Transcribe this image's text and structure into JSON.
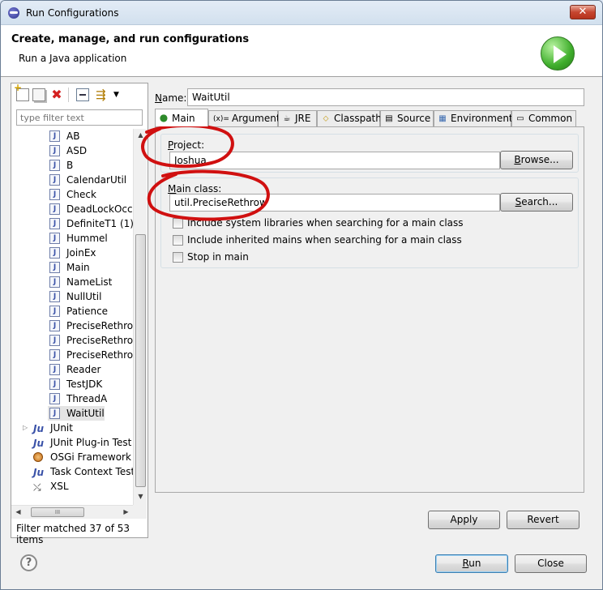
{
  "window": {
    "title": "Run Configurations",
    "close_glyph": "✕"
  },
  "header": {
    "title": "Create, manage, and run configurations",
    "subtitle": "Run a Java application"
  },
  "left_panel": {
    "filter_placeholder": "type filter text",
    "tree": [
      {
        "label": "AB",
        "icon": "java-file-icon"
      },
      {
        "label": "ASD",
        "icon": "java-file-icon"
      },
      {
        "label": "B",
        "icon": "java-file-icon"
      },
      {
        "label": "CalendarUtil",
        "icon": "java-file-icon"
      },
      {
        "label": "Check",
        "icon": "java-file-icon"
      },
      {
        "label": "DeadLockOccu",
        "icon": "java-file-icon"
      },
      {
        "label": "DefiniteT1 (1)",
        "icon": "java-file-icon"
      },
      {
        "label": "Hummel",
        "icon": "java-file-icon"
      },
      {
        "label": "JoinEx",
        "icon": "java-file-icon"
      },
      {
        "label": "Main",
        "icon": "java-file-icon"
      },
      {
        "label": "NameList",
        "icon": "java-file-icon"
      },
      {
        "label": "NullUtil",
        "icon": "java-file-icon"
      },
      {
        "label": "Patience",
        "icon": "java-file-icon"
      },
      {
        "label": "PreciseRethrov",
        "icon": "java-file-icon"
      },
      {
        "label": "PreciseRethrov",
        "icon": "java-file-icon"
      },
      {
        "label": "PreciseRethrov",
        "icon": "java-file-icon"
      },
      {
        "label": "Reader",
        "icon": "java-file-icon"
      },
      {
        "label": "TestJDK",
        "icon": "java-file-icon"
      },
      {
        "label": "ThreadA",
        "icon": "java-file-icon"
      },
      {
        "label": "WaitUtil",
        "icon": "java-file-icon",
        "selected": true
      },
      {
        "label": "JUnit",
        "icon": "junit-icon"
      },
      {
        "label": "JUnit Plug-in Test",
        "icon": "junit-plugin-icon"
      },
      {
        "label": "OSGi Framework",
        "icon": "osgi-icon"
      },
      {
        "label": "Task Context Test",
        "icon": "task-context-icon"
      },
      {
        "label": "XSL",
        "icon": "xsl-icon"
      }
    ],
    "filter_status": "Filter matched 37 of 53 items",
    "hscroll_grip": "III"
  },
  "config": {
    "name_label": "Name:",
    "name_value": "WaitUtil",
    "tabs": [
      {
        "label": "Main",
        "icon": "main-tab-icon",
        "active": true
      },
      {
        "label": "Arguments",
        "icon": "arguments-tab-icon"
      },
      {
        "label": "JRE",
        "icon": "jre-tab-icon"
      },
      {
        "label": "Classpath",
        "icon": "classpath-tab-icon"
      },
      {
        "label": "Source",
        "icon": "source-tab-icon"
      },
      {
        "label": "Environment",
        "icon": "environment-tab-icon"
      },
      {
        "label": "Common",
        "icon": "common-tab-icon"
      }
    ],
    "project_label": "Project:",
    "project_value": "Joshua",
    "browse_label": "Browse...",
    "main_class_label": "Main class:",
    "main_class_value": "util.PreciseRethrow",
    "search_label": "Search...",
    "checkboxes": [
      {
        "label": "Include system libraries when searching for a main class",
        "checked": false
      },
      {
        "label": "Include inherited mains when searching for a main class",
        "checked": false
      },
      {
        "label": "Stop in main",
        "checked": false
      }
    ],
    "apply_label": "Apply",
    "revert_label": "Revert"
  },
  "footer": {
    "help_glyph": "?",
    "run_label": "Run",
    "close_label": "Close"
  },
  "colors": {
    "annotation": "#d01010",
    "selection": "#e4e4e4",
    "default_button_border": "#3c7fb1"
  }
}
